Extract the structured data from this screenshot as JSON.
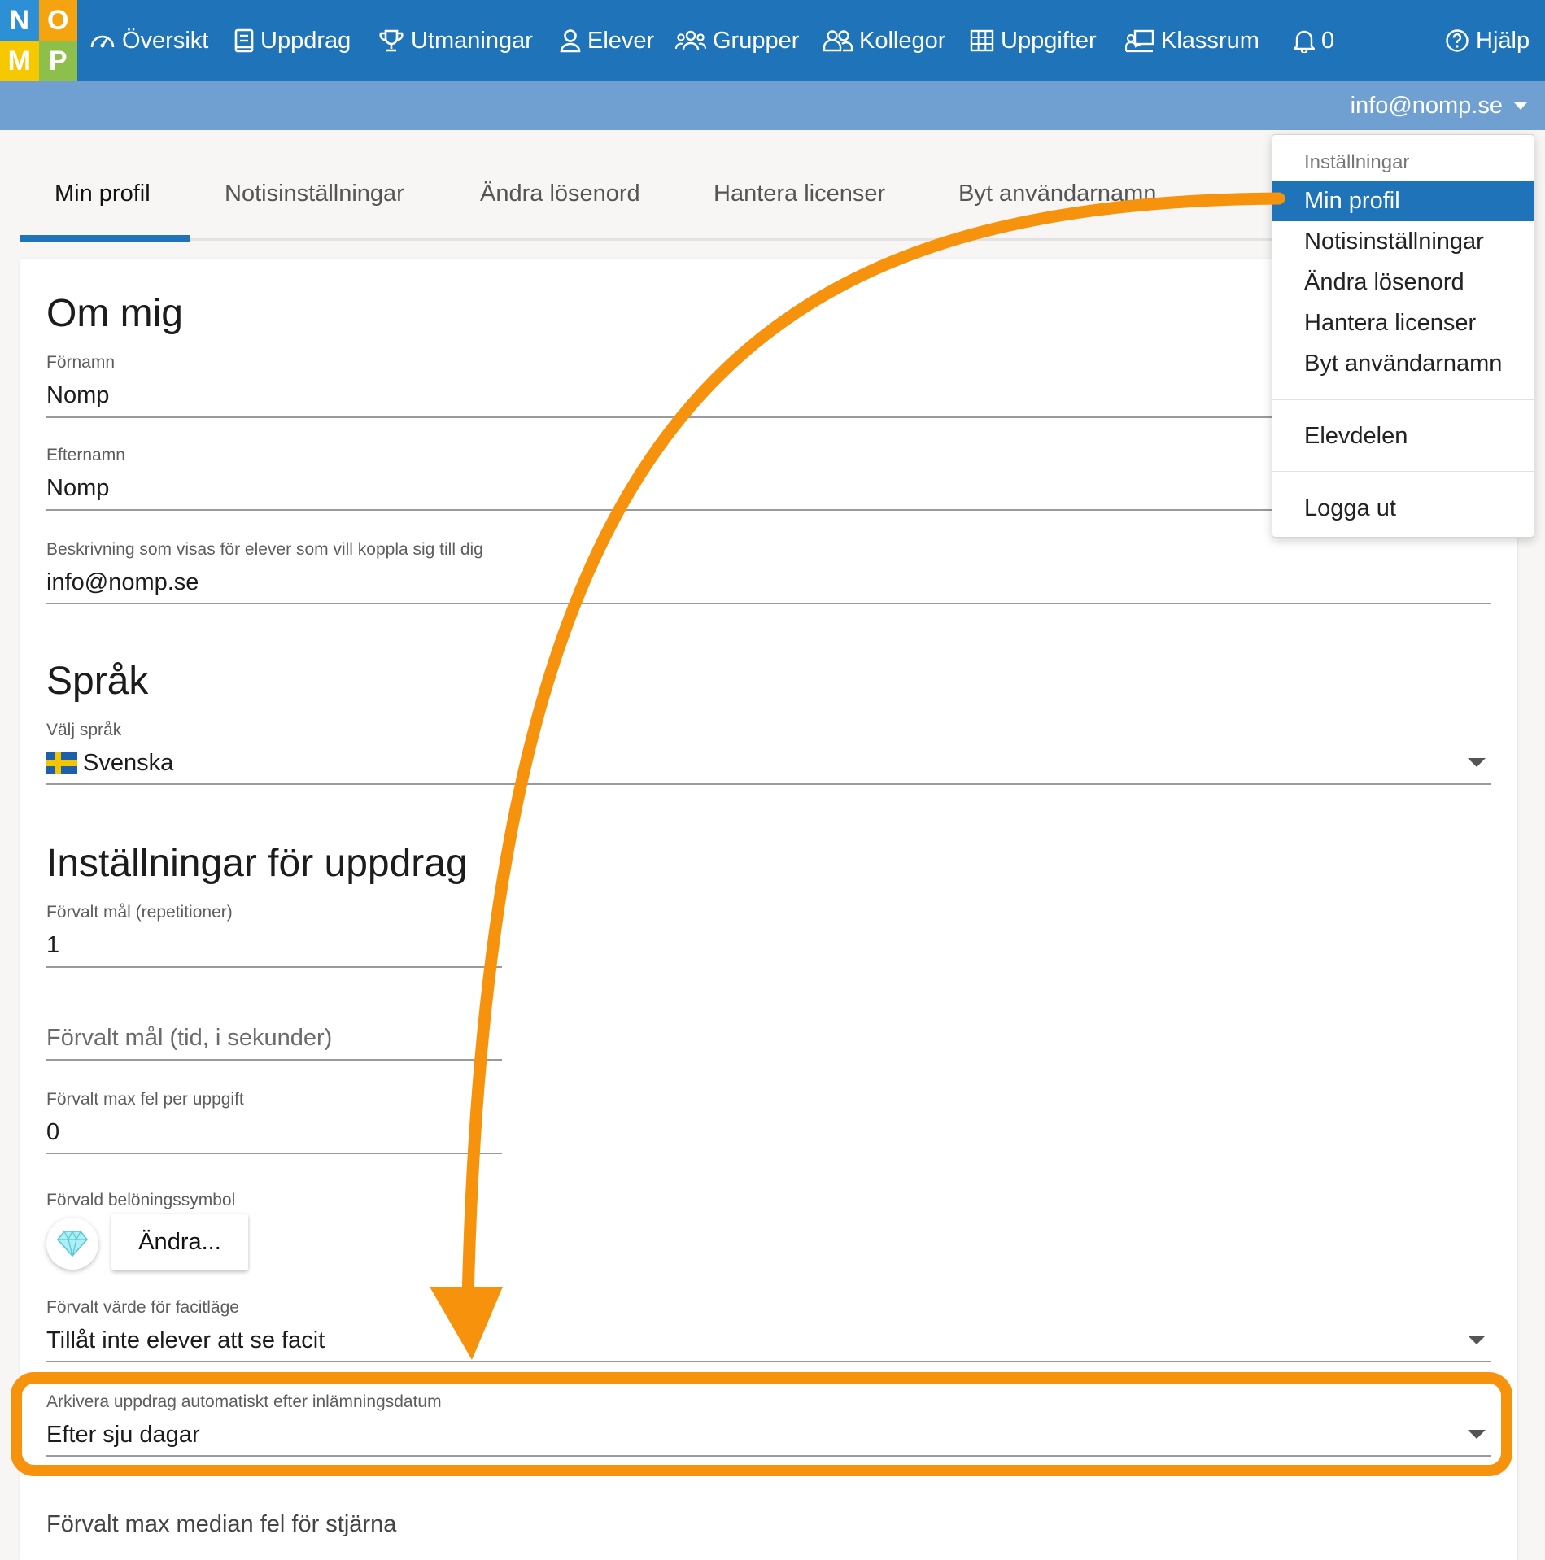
{
  "logo": {
    "letters": [
      "N",
      "O",
      "M",
      "P"
    ],
    "colors": [
      "#2d8fd6",
      "#f5a30f",
      "#f5c800",
      "#8cc04a"
    ]
  },
  "nav": {
    "items": [
      {
        "label": "Översikt",
        "icon": "dashboard-icon"
      },
      {
        "label": "Uppdrag",
        "icon": "book-icon"
      },
      {
        "label": "Utmaningar",
        "icon": "trophy-icon"
      },
      {
        "label": "Elever",
        "icon": "user-icon"
      },
      {
        "label": "Grupper",
        "icon": "users-group-icon"
      },
      {
        "label": "Kollegor",
        "icon": "colleagues-icon"
      },
      {
        "label": "Uppgifter",
        "icon": "grid-icon"
      },
      {
        "label": "Klassrum",
        "icon": "classroom-icon"
      }
    ],
    "notifications": {
      "count": "0",
      "icon": "bell-icon"
    },
    "help": {
      "label": "Hjälp",
      "icon": "help-icon"
    }
  },
  "user_menu": {
    "email": "info@nomp.se"
  },
  "tabs": [
    {
      "label": "Min profil",
      "active": true
    },
    {
      "label": "Notisinställningar",
      "active": false
    },
    {
      "label": "Ändra lösenord",
      "active": false
    },
    {
      "label": "Hantera licenser",
      "active": false
    },
    {
      "label": "Byt användarnamn",
      "active": false
    }
  ],
  "about": {
    "heading": "Om mig",
    "first_name": {
      "label": "Förnamn",
      "value": "Nomp"
    },
    "last_name": {
      "label": "Efternamn",
      "value": "Nomp"
    },
    "description": {
      "label": "Beskrivning som visas för elever som vill koppla sig till dig",
      "value": "info@nomp.se"
    }
  },
  "language": {
    "heading": "Språk",
    "label": "Välj språk",
    "value": "Svenska"
  },
  "assignment_settings": {
    "heading": "Inställningar för uppdrag",
    "default_goal_reps": {
      "label": "Förvalt mål (repetitioner)",
      "value": "1"
    },
    "default_goal_time": {
      "placeholder": "Förvalt mål (tid, i sekunder)"
    },
    "default_max_errors": {
      "label": "Förvalt max fel per uppgift",
      "value": "0"
    },
    "reward_symbol": {
      "label": "Förvald belöningssymbol",
      "button": "Ändra...",
      "icon": "diamond-icon"
    },
    "answer_mode": {
      "label": "Förvalt värde för facitläge",
      "value": "Tillåt inte elever att se facit"
    },
    "auto_archive": {
      "label": "Arkivera uppdrag automatiskt efter inlämningsdatum",
      "value": "Efter sju dagar"
    },
    "next_field_label": "Förvalt max median fel för stjärna"
  },
  "dropdown": {
    "header": "Inställningar",
    "items": [
      {
        "label": "Min profil",
        "active": true
      },
      {
        "label": "Notisinställningar"
      },
      {
        "label": "Ändra lösenord"
      },
      {
        "label": "Hantera licenser"
      },
      {
        "label": "Byt användarnamn"
      }
    ],
    "student_part": "Elevdelen",
    "logout": "Logga ut"
  },
  "colors": {
    "nav_bg": "#1e73b9",
    "subbar_bg": "#6fa0d1",
    "accent": "#1e73b9",
    "highlight_orange": "#f7920c"
  }
}
